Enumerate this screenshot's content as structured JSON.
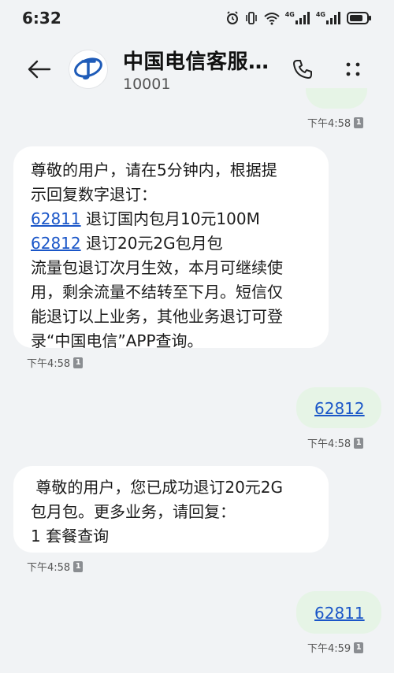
{
  "status_bar": {
    "time": "6:32",
    "network_label_1": "4G",
    "network_label_2": "4G"
  },
  "header": {
    "contact_name": "中国电信客服…",
    "contact_number": "10001"
  },
  "messages": [
    {
      "id": "m0",
      "direction": "out",
      "time": "下午4:58",
      "sim": "1"
    },
    {
      "id": "m1",
      "direction": "in",
      "time": "下午4:58",
      "sim": "1",
      "line1": "尊敬的用户，请在5分钟内，根据提",
      "line2": "示回复数字退订：",
      "code1": "62811",
      "code1_text": " 退订国内包月10元100M",
      "code2": "62812",
      "code2_text": " 退订20元2G包月包",
      "line5": "流量包退订次月生效，本月可继续使",
      "line6": "用，剩余流量不结转至下月。短信仅",
      "line7": "能退订以上业务，其他业务退订可登",
      "line8": "录“中国电信”APP查询。"
    },
    {
      "id": "m2",
      "direction": "out",
      "time": "下午4:58",
      "sim": "1",
      "text": "62812"
    },
    {
      "id": "m3",
      "direction": "in",
      "time": "下午4:58",
      "sim": "1",
      "line1": " 尊敬的用户，您已成功退订20元2G",
      "line2": "包月包。更多业务，请回复：",
      "line3": "1 套餐查询"
    },
    {
      "id": "m4",
      "direction": "out",
      "time": "下午4:59",
      "sim": "1",
      "text": "62811"
    }
  ],
  "icons": {
    "back": "arrow-left-icon",
    "call": "phone-icon",
    "more": "more-vertical-icon",
    "avatar": "china-telecom-logo",
    "alarm": "alarm-icon",
    "vibrate": "vibrate-icon",
    "wifi": "wifi-icon",
    "signal": "signal-icon",
    "battery": "battery-icon"
  },
  "colors": {
    "background": "#f1f3f5",
    "incoming_bubble": "#ffffff",
    "outgoing_bubble": "#e6f4e6",
    "link": "#1a56c8",
    "brand": "#1e5bb8"
  }
}
